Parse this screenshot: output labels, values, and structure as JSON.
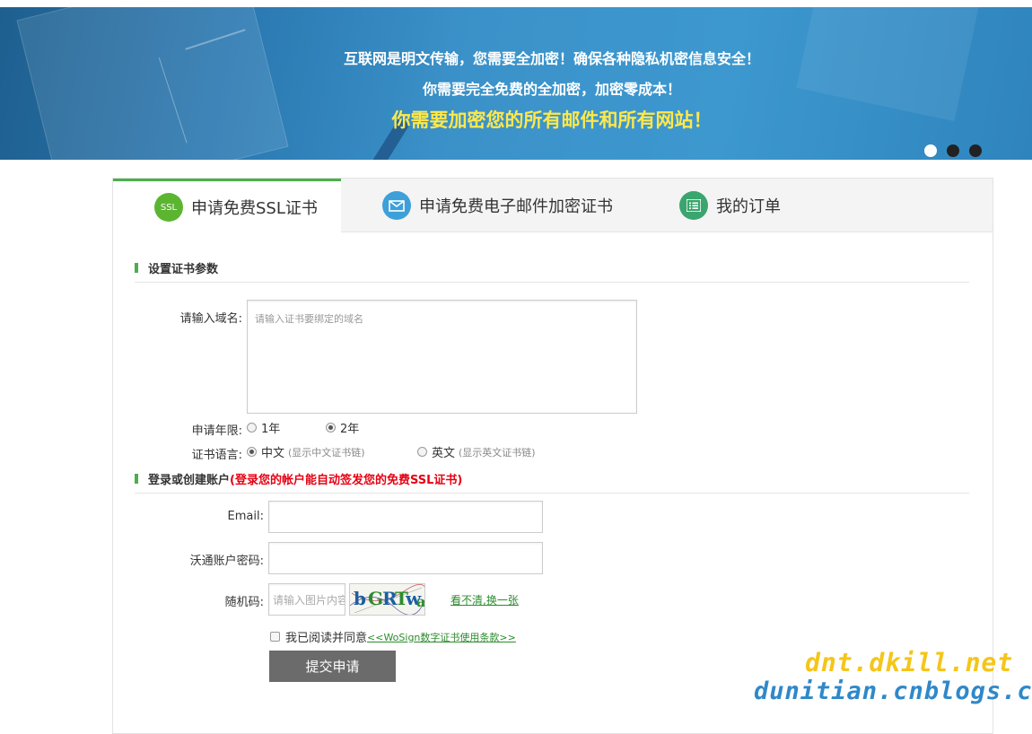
{
  "banner": {
    "line1": "互联网是明文传输，您需要全加密！确保各种隐私机密信息安全！",
    "line2": "你需要完全免费的全加密，加密零成本！",
    "line3": "你需要加密您的所有邮件和所有网站！",
    "slides": 3,
    "active_slide": 1
  },
  "tabs": [
    {
      "label": "申请免费SSL证书",
      "icon": "ssl-icon",
      "icon_text": "SSL",
      "active": true
    },
    {
      "label": "申请免费电子邮件加密证书",
      "icon": "envelope-icon",
      "active": false
    },
    {
      "label": "我的订单",
      "icon": "list-icon",
      "active": false
    }
  ],
  "section1": {
    "title": "设置证书参数"
  },
  "domain": {
    "label": "请输入域名:",
    "placeholder": "请输入证书要绑定的域名"
  },
  "period": {
    "label": "申请年限:",
    "options": [
      "1年",
      "2年"
    ],
    "selected": "2年"
  },
  "language": {
    "label": "证书语言:",
    "options": [
      {
        "label": "中文",
        "note": "(显示中文证书链)"
      },
      {
        "label": "英文",
        "note": "(显示英文证书链)"
      }
    ],
    "selected": "中文"
  },
  "section2": {
    "title": "登录或创建账户",
    "note": "(登录您的帐户能自动签发您的免费SSL证书)"
  },
  "email": {
    "label": "Email:",
    "value": ""
  },
  "password": {
    "label": "沃通账户密码:",
    "value": ""
  },
  "captcha": {
    "label": "随机码:",
    "placeholder": "请输入图片内容",
    "image_text": "bGRTwa",
    "refresh_link": "看不清,换一张"
  },
  "agreement": {
    "text": "我已阅读并同意",
    "link": "<<WoSign数字证书使用条款>>"
  },
  "submit": {
    "label": "提交申请"
  },
  "watermark": {
    "line1": "dnt.dkill.net",
    "line2": "dunitian.cnblogs.com"
  },
  "colors": {
    "accent": "#4cae4c",
    "warning": "#e60012",
    "link": "#2e8b2e",
    "banner_highlight": "#ffe84a"
  }
}
